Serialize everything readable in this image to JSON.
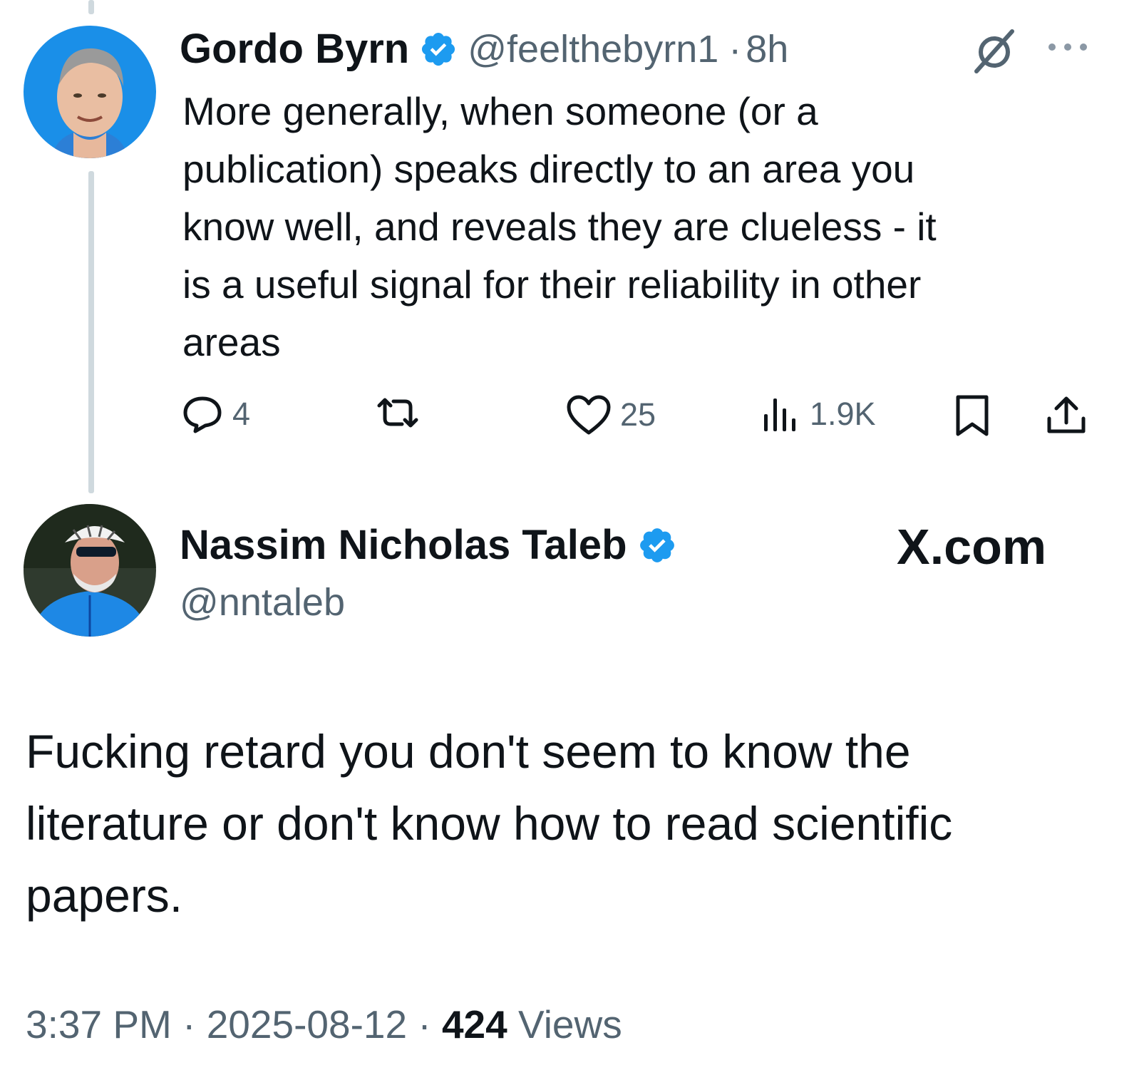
{
  "reply": {
    "author_name": "Gordo Byrn",
    "author_handle": "@feelthebyrn1",
    "separator": "·",
    "time_ago": "8h",
    "body": "More generally, when someone (or a\npublication) speaks directly to an area you\nknow well, and reveals they are clueless - it\nis a useful signal for their reliability in other\nareas",
    "actions": {
      "replies": "4",
      "reposts": "",
      "likes": "25",
      "views": "1.9K"
    },
    "icons": [
      "grok-icon",
      "more-icon",
      "reply-icon",
      "repost-icon",
      "like-icon",
      "views-icon",
      "bookmark-icon",
      "share-icon"
    ]
  },
  "main_tweet": {
    "author_name": "Nassim Nicholas Taleb",
    "author_handle": "@nntaleb",
    "body": "Fucking retard you don't seem to know the\nliterature or don't know how to read scientific\npapers.",
    "time": "3:37 PM",
    "date": "2025-08-12",
    "separator": "·",
    "views_count": "424",
    "views_label": " Views"
  },
  "watermark": "X.com",
  "colors": {
    "text": "#0f1419",
    "secondary": "#536471",
    "verified": "#1d9bf0",
    "thread_line": "#cfd9de"
  }
}
